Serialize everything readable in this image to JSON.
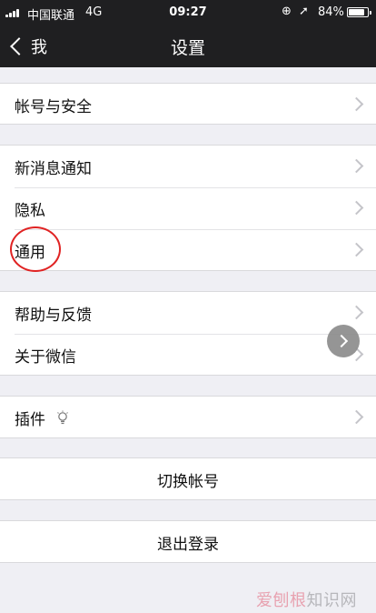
{
  "status_bar": {
    "carrier": "中国联通",
    "network": "4G",
    "time": "09:27",
    "battery_text": "84%",
    "battery_level": 0.84
  },
  "nav": {
    "back_label": "我",
    "title": "设置"
  },
  "sections": {
    "account": {
      "label": "帐号与安全"
    },
    "notifications": {
      "label": "新消息通知"
    },
    "privacy": {
      "label": "隐私"
    },
    "general": {
      "label": "通用"
    },
    "help": {
      "label": "帮助与反馈"
    },
    "about": {
      "label": "关于微信"
    },
    "plugins": {
      "label": "插件"
    }
  },
  "actions": {
    "switch_account": "切换帐号",
    "logout": "退出登录"
  },
  "watermark": {
    "part1": "爱刨根",
    "part2": "知识网"
  },
  "colors": {
    "nav_bg": "#1f1f21",
    "page_bg": "#efeff4",
    "annotation_circle": "#e02323"
  }
}
